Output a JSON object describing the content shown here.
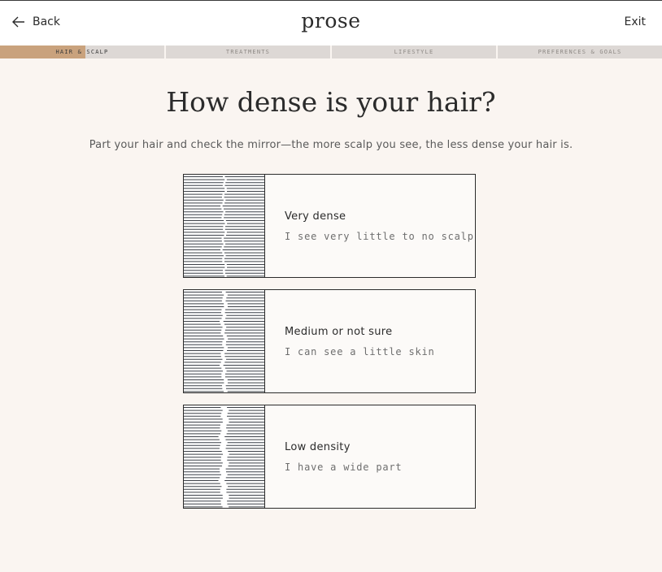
{
  "header": {
    "back_label": "Back",
    "logo": "prose",
    "exit_label": "Exit"
  },
  "progress": {
    "steps": [
      {
        "label": "HAIR & SCALP",
        "fill": 0.52
      },
      {
        "label": "TREATMENTS",
        "fill": 0
      },
      {
        "label": "LIFESTYLE",
        "fill": 0
      },
      {
        "label": "PREFERENCES & GOALS",
        "fill": 0
      }
    ]
  },
  "question": {
    "title": "How dense is your hair?",
    "subtitle": "Part your hair and check the mirror—the more scalp you see, the less dense your hair is."
  },
  "options": [
    {
      "label": "Very dense",
      "description": "I see very little to no scalp",
      "icon": "dense-hair-icon"
    },
    {
      "label": "Medium or not sure",
      "description": "I can see a little skin",
      "icon": "medium-hair-icon"
    },
    {
      "label": "Low density",
      "description": "I have a wide part",
      "icon": "low-density-hair-icon"
    }
  ]
}
